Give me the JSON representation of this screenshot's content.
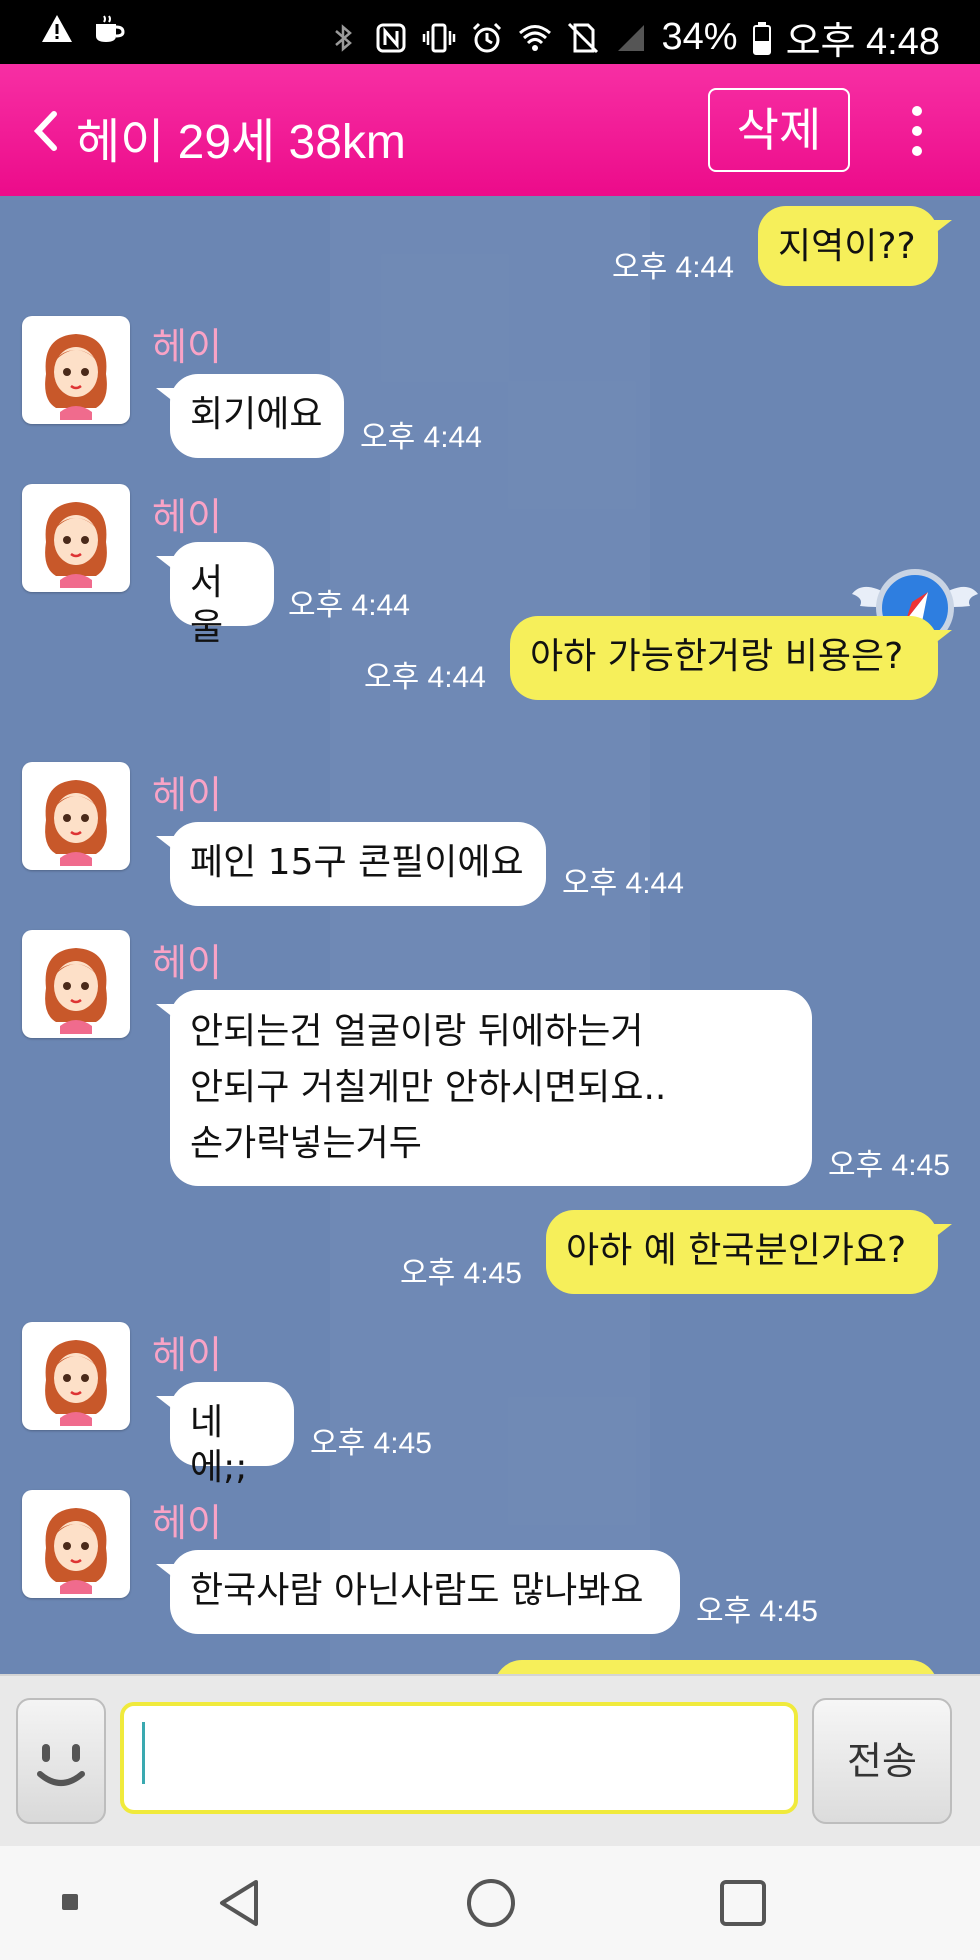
{
  "status_bar": {
    "battery": "34%",
    "time": "오후 4:48",
    "icons": [
      "warning-icon",
      "coffee-icon",
      "bluetooth-icon",
      "nfc-icon",
      "vibrate-icon",
      "alarm-icon",
      "wifi-icon",
      "no-sim-icon",
      "signal-icon",
      "battery-icon"
    ]
  },
  "header": {
    "title": "헤이 29세 38km",
    "delete_label": "삭제",
    "back_icon": "chevron-left-icon",
    "menu_icon": "more-vertical-icon",
    "color": "#f21d97"
  },
  "messages": [
    {
      "dir": "out",
      "text": "지역이??",
      "time": "오후 4:44"
    },
    {
      "dir": "in",
      "sender": "헤이",
      "text": "회기에요",
      "time": "오후 4:44"
    },
    {
      "dir": "in",
      "sender": "헤이",
      "text": "서울",
      "time": "오후 4:44"
    },
    {
      "dir": "out",
      "text": "아하 가능한거랑 비용은?",
      "time": "오후 4:44"
    },
    {
      "dir": "in",
      "sender": "헤이",
      "text": "페인 15구 콘필이에요",
      "time": "오후 4:44"
    },
    {
      "dir": "in",
      "sender": "헤이",
      "text": "안되는건 얼굴이랑 뒤에하는거\n안되구 거칠게만 안하시면되요..\n손가락넣는거두",
      "time": "오후 4:45"
    },
    {
      "dir": "out",
      "text": "아하 예 한국분인가요?",
      "time": "오후 4:45"
    },
    {
      "dir": "in",
      "sender": "헤이",
      "text": "네에;;",
      "time": "오후 4:45"
    },
    {
      "dir": "in",
      "sender": "헤이",
      "text": "한국사람 아닌사람도 많나봐요",
      "time": "오후 4:45"
    }
  ],
  "input": {
    "placeholder": "",
    "value": "",
    "send_label": "전송",
    "emoji_icon": "smiley-icon"
  },
  "colors": {
    "chat_bg": "#6b86b3",
    "out_bubble": "#f6ef5a",
    "in_bubble": "#ffffff",
    "sender_name": "#f9a3c6"
  }
}
